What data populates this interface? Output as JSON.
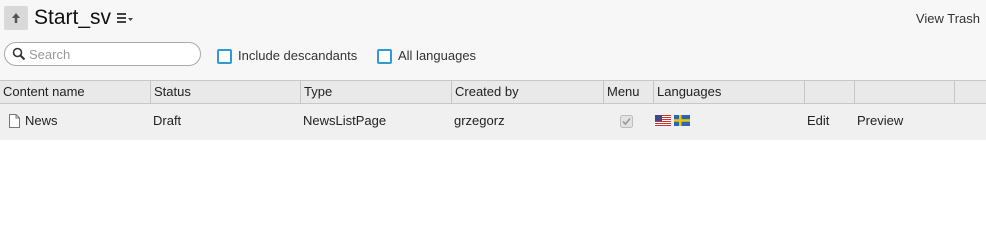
{
  "header": {
    "title": "Start_sv",
    "view_trash": "View Trash",
    "up_icon": "arrow-up-icon",
    "menu_icon": "context-menu-icon"
  },
  "filters": {
    "search_placeholder": "Search",
    "search_value": "",
    "include_descendants_label": "Include descandants",
    "include_descendants_checked": false,
    "all_languages_label": "All languages",
    "all_languages_checked": false
  },
  "grid": {
    "columns": [
      "Content name",
      "Status",
      "Type",
      "Created by",
      "Menu",
      "Languages",
      "",
      ""
    ],
    "rows": [
      {
        "name": "News",
        "status": "Draft",
        "type": "NewsListPage",
        "created_by": "grzegorz",
        "menu_checked": true,
        "languages": [
          "en-US",
          "sv"
        ],
        "edit": "Edit",
        "preview": "Preview"
      }
    ]
  },
  "colors": {
    "checkbox_border": "#2e9bd8",
    "header_bg": "#e9e9e9",
    "row_bg": "#f0f0f0",
    "topbar_bg": "#f7f7f7"
  }
}
